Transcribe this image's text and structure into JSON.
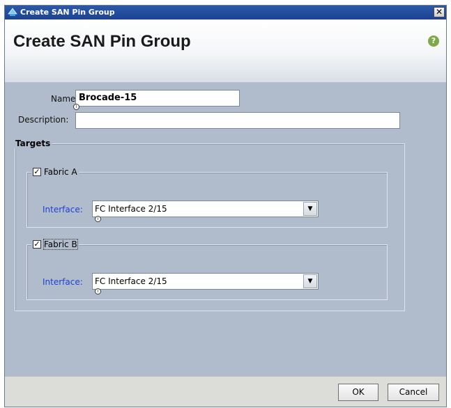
{
  "window": {
    "title": "Create SAN Pin Group",
    "close_glyph": "✕",
    "icon": "app-icon"
  },
  "header": {
    "title": "Create SAN Pin Group",
    "help_glyph": "?",
    "help_icon_color": "#7fa84a"
  },
  "form": {
    "name_label": "Name:",
    "name_value": "Brocade-15",
    "description_label": "Description:",
    "description_value": ""
  },
  "targets": {
    "legend": "Targets",
    "fabric_a": {
      "label": "Fabric A",
      "checked": true,
      "interface_label": "Interface:",
      "interface_value": "FC Interface 2/15"
    },
    "fabric_b": {
      "label": "Fabric B",
      "checked": true,
      "interface_label": "Interface:",
      "interface_value": "FC Interface 2/15"
    }
  },
  "footer": {
    "ok_label": "OK",
    "cancel_label": "Cancel"
  },
  "glyphs": {
    "check": "✓",
    "dropdown": "▼",
    "info": "i"
  },
  "colors": {
    "titlebar": "#1d4292",
    "body": "#b0bccb",
    "interface_label": "#1f3fd6"
  }
}
